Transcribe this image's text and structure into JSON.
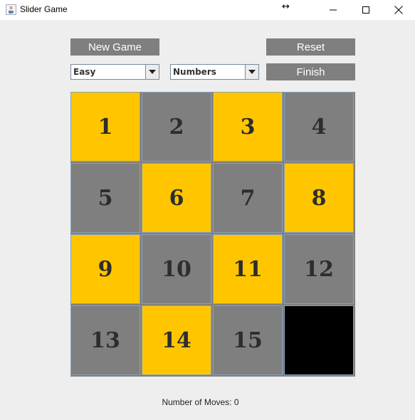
{
  "window": {
    "title": "Slider Game",
    "icon": "java-cup-icon"
  },
  "controls": {
    "new_game_label": "New Game",
    "reset_label": "Reset",
    "finish_label": "Finish",
    "difficulty_selected": "Easy",
    "mode_selected": "Numbers"
  },
  "board": {
    "tiles": [
      {
        "label": "1",
        "color": "#ffc600"
      },
      {
        "label": "2",
        "color": "#7f7f7f"
      },
      {
        "label": "3",
        "color": "#ffc600"
      },
      {
        "label": "4",
        "color": "#7f7f7f"
      },
      {
        "label": "5",
        "color": "#7f7f7f"
      },
      {
        "label": "6",
        "color": "#ffc600"
      },
      {
        "label": "7",
        "color": "#7f7f7f"
      },
      {
        "label": "8",
        "color": "#ffc600"
      },
      {
        "label": "9",
        "color": "#ffc600"
      },
      {
        "label": "10",
        "color": "#7f7f7f"
      },
      {
        "label": "11",
        "color": "#ffc600"
      },
      {
        "label": "12",
        "color": "#7f7f7f"
      },
      {
        "label": "13",
        "color": "#7f7f7f"
      },
      {
        "label": "14",
        "color": "#ffc600"
      },
      {
        "label": "15",
        "color": "#7f7f7f"
      },
      {
        "label": "",
        "color": "#000000"
      }
    ]
  },
  "status": {
    "moves_text": "Number of Moves: 0"
  }
}
